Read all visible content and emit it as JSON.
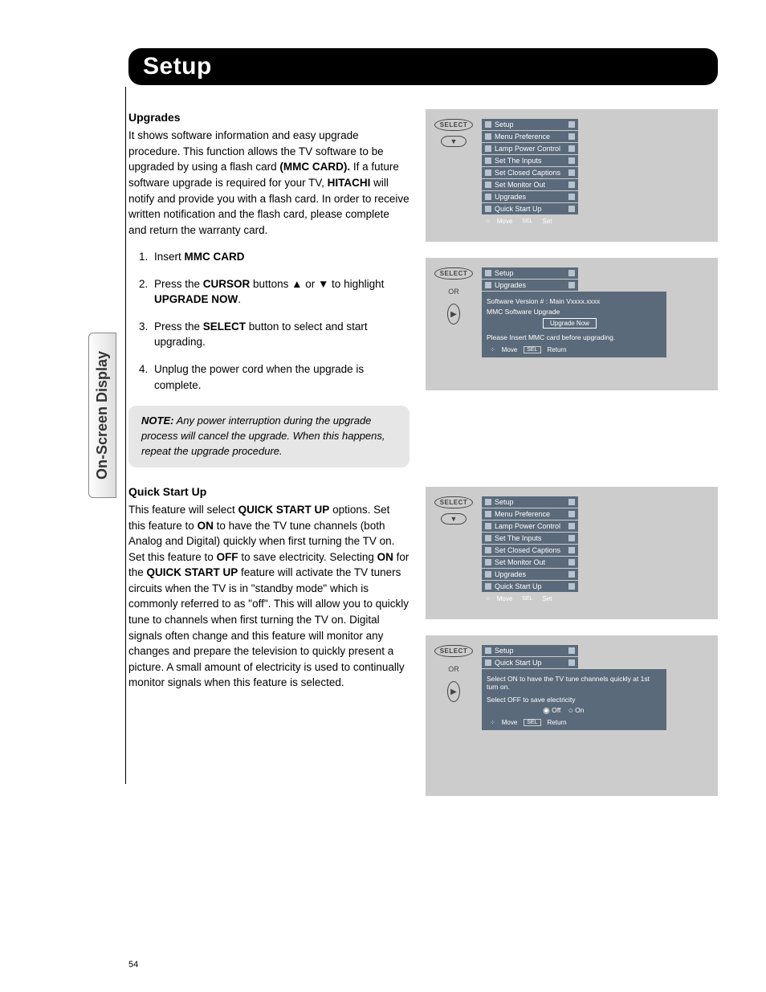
{
  "pageNumber": "54",
  "sideTab": "On-Screen Display",
  "titleBar": "Setup",
  "upgrades": {
    "heading": "Upgrades",
    "intro_a": "It shows software information and easy upgrade procedure. This function allows the TV software to be upgraded by using a flash card ",
    "mmc": "(MMC CARD).",
    "intro_b": " If a future software upgrade is required for your TV, ",
    "hitachi": "HITACHI",
    "intro_c": " will notify and provide you with a flash card. In order to receive written notification and the flash card, please complete and return the warranty card.",
    "step1_a": "Insert ",
    "step1_b": "MMC CARD",
    "step2_a": "Press the ",
    "step2_b": "CURSOR",
    "step2_c": " buttons ▲ or ▼ to highlight ",
    "step2_d": "UPGRADE NOW",
    "step2_e": ".",
    "step3_a": "Press the ",
    "step3_b": "SELECT",
    "step3_c": " button to select and start upgrading.",
    "step4": "Unplug the power cord when the upgrade is complete."
  },
  "note": {
    "label": "NOTE:",
    "text": "Any power interruption during the upgrade process will cancel the upgrade. When this happens, repeat the upgrade procedure."
  },
  "quickstart": {
    "heading": "Quick Start Up",
    "p1": "This feature will select ",
    "b1": "QUICK START UP",
    "p2": " options. Set this feature to ",
    "b2": "ON",
    "p3": " to have the TV tune channels (both Analog and Digital) quickly when first turning the TV on. Set this feature to ",
    "b3": "OFF",
    "p4": " to save electricity. Selecting ",
    "b4": "ON",
    "p5": " for the ",
    "b5": "QUICK START UP",
    "p6": " feature will activate the TV tuners circuits when the TV is in \"standby mode\" which is commonly referred to as \"off\". This will allow you to quickly tune to channels when first turning the TV on. Digital signals often change and this feature will monitor any changes and prepare the television to quickly present a picture. A small amount of electricity is used to continually monitor signals when this feature is selected."
  },
  "controls": {
    "select": "SELECT",
    "or": "OR",
    "down": "▼",
    "right": "▶"
  },
  "menu": {
    "setup": "Setup",
    "items": [
      "Menu Preference",
      "Lamp Power Control",
      "Set The Inputs",
      "Set Closed Captions",
      "Set Monitor Out",
      "Upgrades",
      "Quick Start Up"
    ],
    "move": "Move",
    "set": "Set",
    "return": "Return",
    "sel": "SEL",
    "arrows": "⁘"
  },
  "panel2": {
    "crumb": "Upgrades",
    "version": "Software Version #  :  Main Vxxxx.xxxx",
    "mmcUpgrade": "MMC Software Upgrade",
    "upgradeNow": "Upgrade Now",
    "insertCard": "Please Insert MMC card before upgrading."
  },
  "panel4": {
    "crumb": "Quick Start Up",
    "line1": "Select ON to have the TV tune channels quickly at 1st turn on.",
    "line2": "Select OFF to save electricity",
    "off": "Off",
    "on": "On"
  }
}
